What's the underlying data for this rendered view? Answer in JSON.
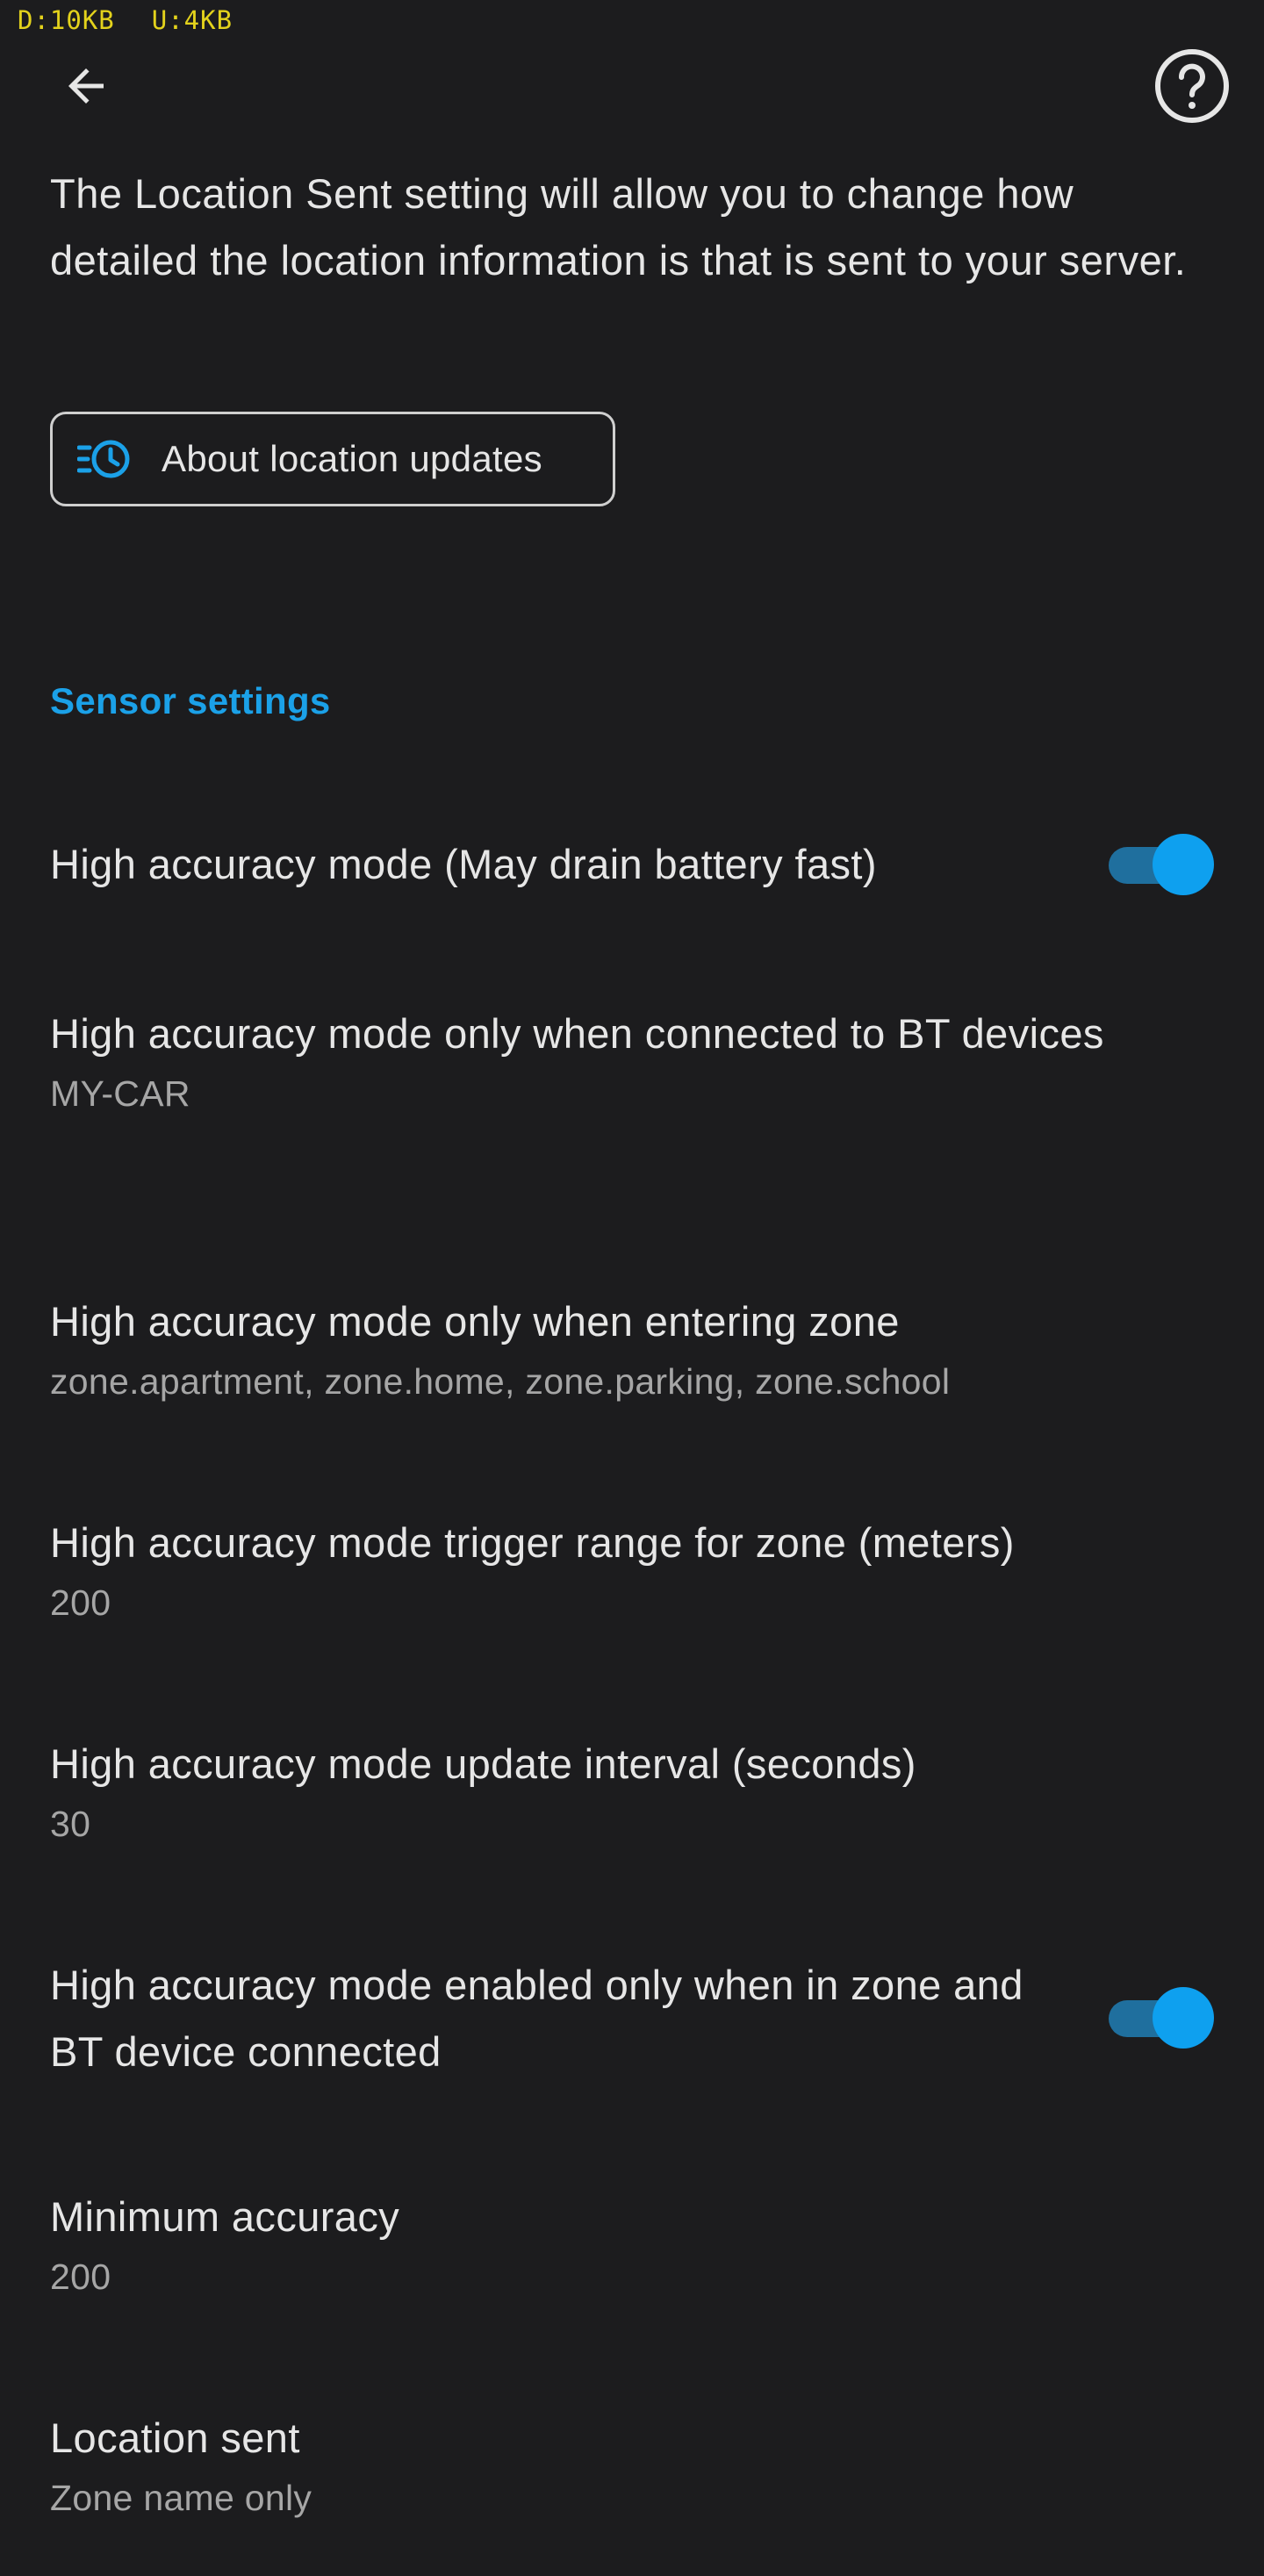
{
  "status_overlay": {
    "download": "D:10KB",
    "upload": "U:4KB"
  },
  "toolbar": {
    "back_icon": "arrow-left-icon",
    "help_icon": "help-circle-icon"
  },
  "intro_text": "The Location Sent setting will allow you to change how detailed the location information is that is sent to your server.",
  "about_button": {
    "label": "About location updates",
    "icon": "location-history-icon"
  },
  "section": {
    "title": "Sensor settings"
  },
  "preferences": [
    {
      "title": "High accuracy mode (May drain battery fast)",
      "toggle": true
    },
    {
      "title": "High accuracy mode only when connected to BT devices",
      "summary": "MY-CAR"
    },
    {
      "title": "High accuracy mode only when entering zone",
      "summary": "zone.apartment, zone.home, zone.parking, zone.school"
    },
    {
      "title": "High accuracy mode trigger range for zone (meters)",
      "summary": "200"
    },
    {
      "title": "High accuracy mode update interval (seconds)",
      "summary": "30"
    },
    {
      "title": "High accuracy mode enabled only when in zone and BT device connected",
      "toggle": true
    },
    {
      "title": "Minimum accuracy",
      "summary": "200"
    },
    {
      "title": "Location sent",
      "summary": "Zone name only"
    }
  ],
  "colors": {
    "background": "#1c1c1e",
    "accent": "#1ba1e8",
    "toggle_track": "#1f6f9e",
    "toggle_thumb": "#0ea0ef",
    "debug_text": "#e3d21c"
  }
}
